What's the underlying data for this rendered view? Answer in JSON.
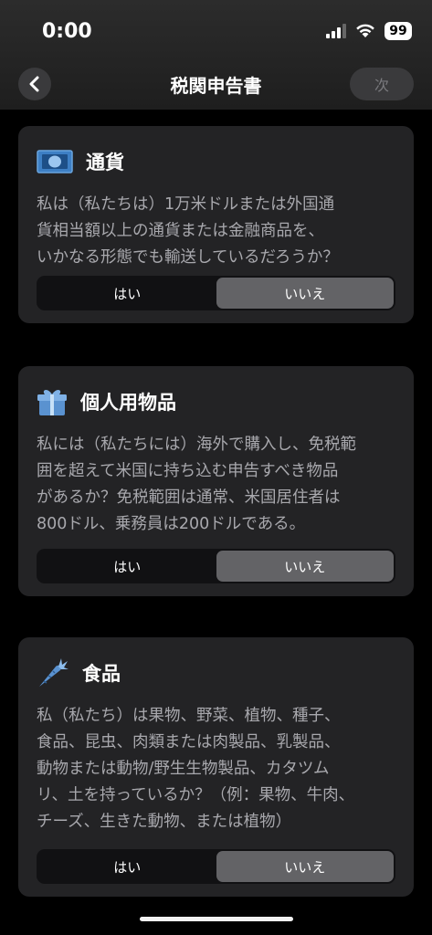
{
  "status_bar": {
    "time": "0:00",
    "battery": "99"
  },
  "nav": {
    "title": "税関申告書",
    "next_label": "次"
  },
  "cards": [
    {
      "title": "通貨",
      "icon": "currency-icon",
      "lines": [
        "私は（私たちは）1万米ドルまたは外国通",
        "貨相当額以上の通貨または金融商品を、",
        "いかなる形態でも輸送しているだろうか？"
      ],
      "yes": "はい",
      "no": "いいえ",
      "selected": "no"
    },
    {
      "title": "個人用物品",
      "icon": "gift-icon",
      "lines": [
        "私には（私たちには）海外で購入し、免税範",
        "囲を超えて米国に持ち込む申告すべき物品",
        "があるか？免税範囲は通常、米国居住者は",
        "800ドル、乗務員は200ドルである。"
      ],
      "yes": "はい",
      "no": "いいえ",
      "selected": "no"
    },
    {
      "title": "食品",
      "icon": "carrot-icon",
      "lines": [
        "私（私たち）は果物、野菜、植物、種子、",
        "食品、昆虫、肉類または肉製品、乳製品、",
        "動物または動物/野生生物製品、カタツム",
        "リ、土を持っているか？（例：果物、牛肉、",
        "チーズ、生きた動物、または植物）"
      ],
      "yes": "はい",
      "no": "いいえ",
      "selected": "no"
    }
  ]
}
